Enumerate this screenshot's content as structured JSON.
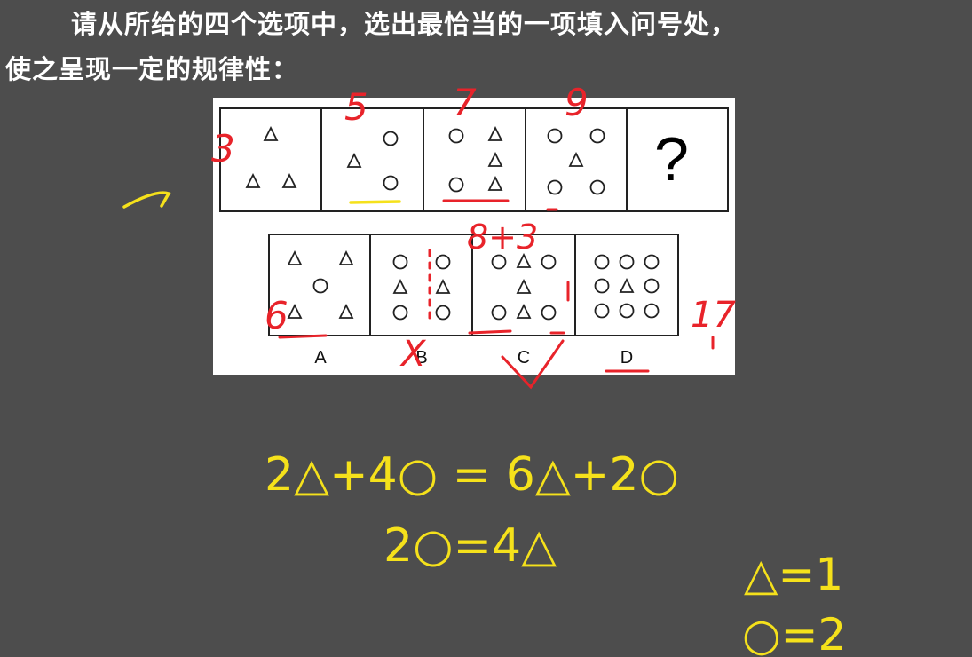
{
  "question": {
    "line1": "请从所给的四个选项中，选出最恰当的一项填入问号处，",
    "line2": "使之呈现一定的规律性："
  },
  "puzzle": {
    "question_mark": "?",
    "option_labels": [
      "A",
      "B",
      "C",
      "D"
    ]
  },
  "annotations": {
    "stroke_counts": [
      "3",
      "5",
      "7",
      "9"
    ],
    "option_a_note": "6",
    "option_c_note": "8+3",
    "option_d_note": "17",
    "option_b_mark": "X",
    "equation1": "2△+4○ = 6△+2○",
    "equation2": "2○=4△",
    "result1": "△=1",
    "result2": "○=2",
    "colors": {
      "red": "#e8232a",
      "yellow": "#f5e11b",
      "background": "#4d4d4d"
    }
  }
}
